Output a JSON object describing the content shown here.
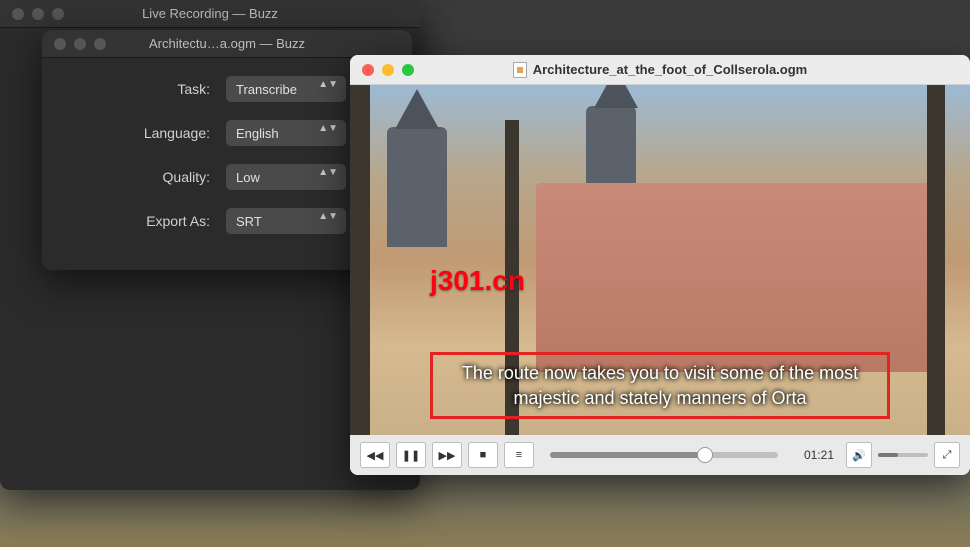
{
  "buzz_main": {
    "title": "Live Recording — Buzz"
  },
  "buzz_settings": {
    "title": "Architectu…a.ogm — Buzz",
    "fields": {
      "task": {
        "label": "Task:",
        "value": "Transcribe"
      },
      "language": {
        "label": "Language:",
        "value": "English"
      },
      "quality": {
        "label": "Quality:",
        "value": "Low"
      },
      "export": {
        "label": "Export As:",
        "value": "SRT"
      }
    }
  },
  "video": {
    "title": "Architecture_at_the_foot_of_Collserola.ogm",
    "watermark": "j301.cn",
    "caption": "The route now takes you to visit some of the most majestic and stately manners of Orta",
    "time": "01:21",
    "progress_pct": 68,
    "volume_pct": 40
  }
}
